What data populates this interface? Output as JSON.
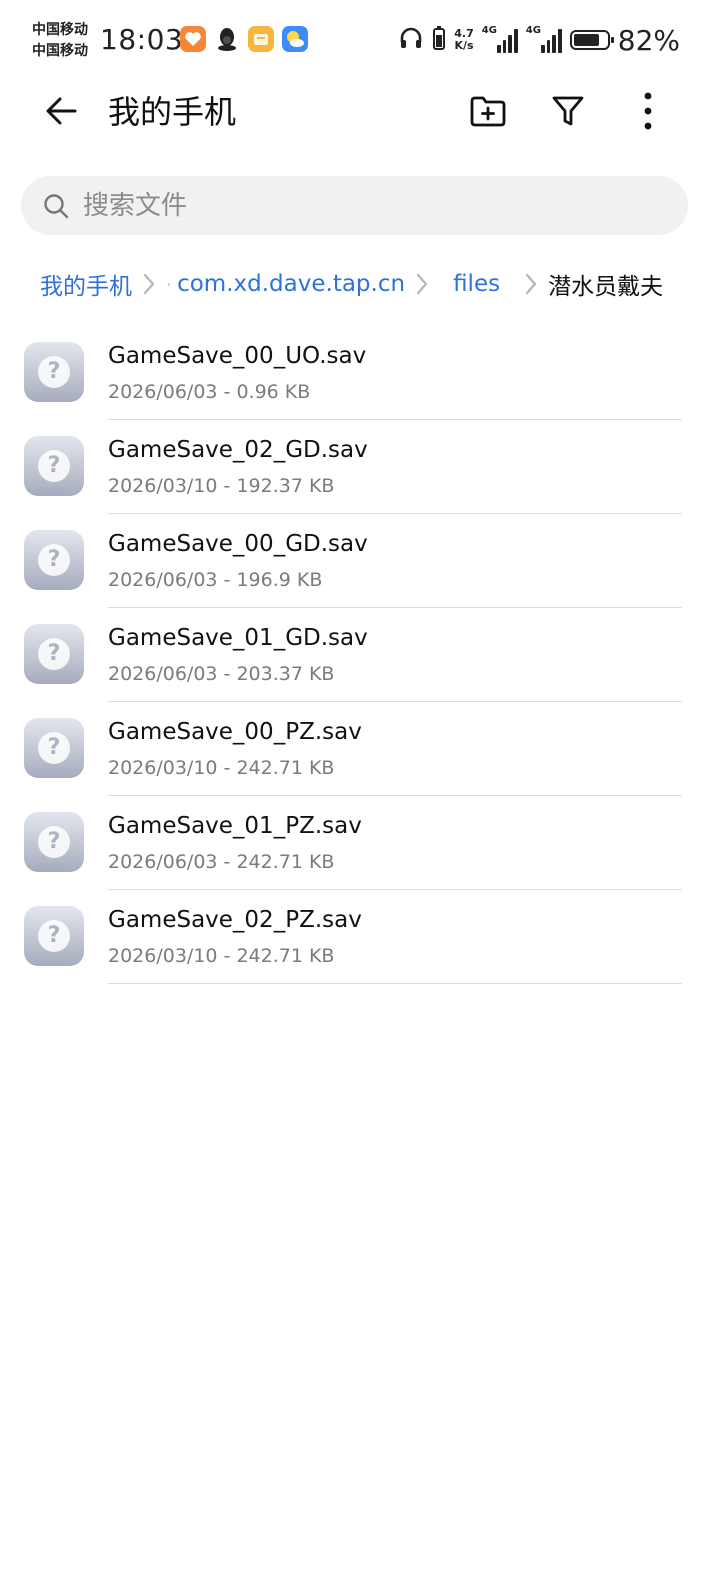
{
  "status_bar": {
    "carrier_1": "中国移动",
    "carrier_2": "中国移动",
    "time": "18:03",
    "net_speed_value": "4.7",
    "net_speed_unit": "K/s",
    "sim1_type": "4G",
    "sim2_type": "4G",
    "battery_percent": "82%",
    "battery_level": 0.82,
    "app_icons": [
      "health-app-icon",
      "qq-icon",
      "memo-app-icon",
      "weather-app-icon"
    ],
    "colors": {
      "health": "#f5873b",
      "memo": "#f6b73c",
      "weather": "#3d8bf5"
    }
  },
  "appbar": {
    "title": "我的手机",
    "actions": [
      "new-folder-icon",
      "filter-icon",
      "more-vertical-icon"
    ]
  },
  "search": {
    "placeholder": "搜索文件",
    "value": ""
  },
  "breadcrumb": {
    "items": [
      {
        "label": "我的手机"
      },
      {
        "label": "com.xd.dave.tap.cn"
      },
      {
        "label": "files"
      },
      {
        "label": "潜水员戴夫"
      }
    ],
    "link_color": "#2f73d8"
  },
  "files": [
    {
      "name": "GameSave_00_UO.sav",
      "meta": "2026/06/03 - 0.96 KB"
    },
    {
      "name": "GameSave_02_GD.sav",
      "meta": "2026/03/10 - 192.37 KB"
    },
    {
      "name": "GameSave_00_GD.sav",
      "meta": "2026/06/03 - 196.9 KB"
    },
    {
      "name": "GameSave_01_GD.sav",
      "meta": "2026/06/03 - 203.37 KB"
    },
    {
      "name": "GameSave_00_PZ.sav",
      "meta": "2026/03/10 - 242.71 KB"
    },
    {
      "name": "GameSave_01_PZ.sav",
      "meta": "2026/06/03 - 242.71 KB"
    },
    {
      "name": "GameSave_02_PZ.sav",
      "meta": "2026/03/10 - 242.71 KB"
    }
  ],
  "file_icon": {
    "glyph": "?"
  }
}
